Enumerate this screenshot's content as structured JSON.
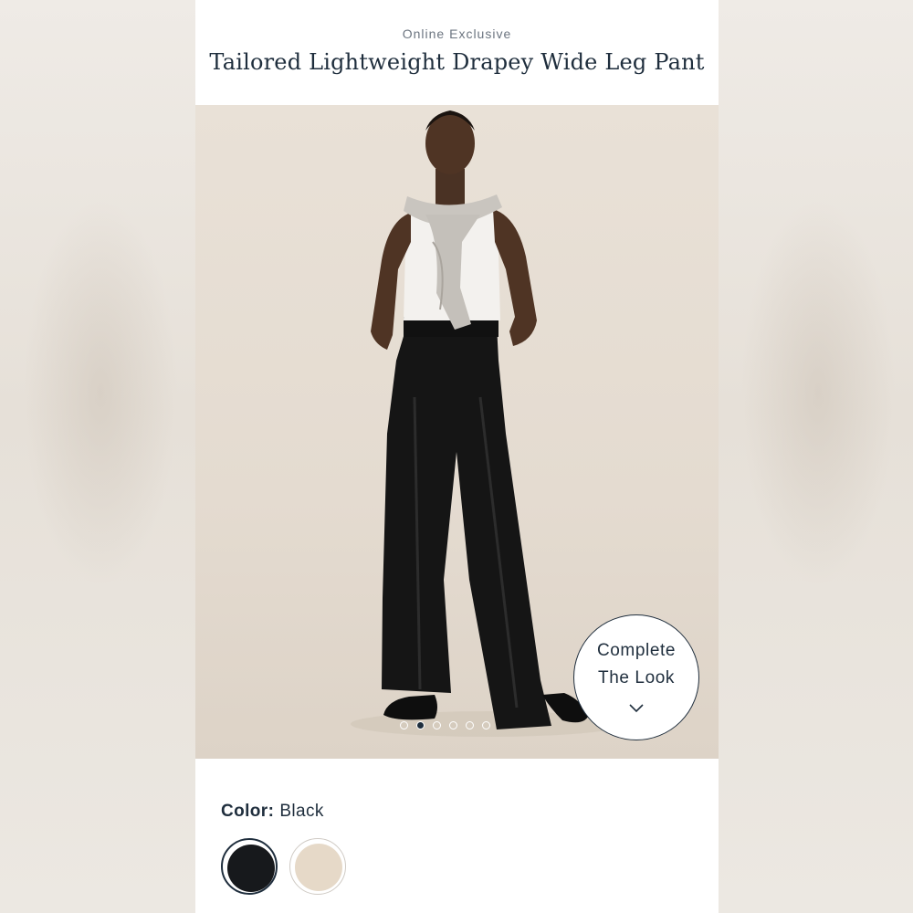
{
  "product": {
    "eyebrow": "Online Exclusive",
    "title": "Tailored Lightweight Drapey Wide Leg Pant"
  },
  "carousel": {
    "image_alt": "Model wearing black wide leg pants with white tank and grey sweater",
    "total_slides": 6,
    "active_slide": 2
  },
  "complete_the_look": {
    "line1": "Complete",
    "line2": "The Look",
    "icon": "chevron-down-icon"
  },
  "color": {
    "label": "Color:",
    "selected": "Black",
    "swatches": [
      {
        "name": "Black",
        "hex": "#17191c",
        "selected": true
      },
      {
        "name": "Beige",
        "hex": "#e6d9c8",
        "selected": false
      }
    ]
  },
  "colors": {
    "text_primary": "#1f2e3d",
    "text_secondary": "#6c7580",
    "hero_background": "#e6ddd2"
  }
}
